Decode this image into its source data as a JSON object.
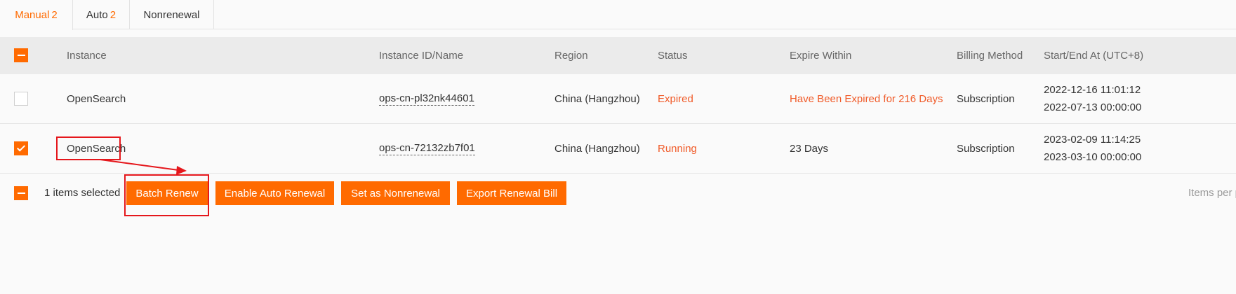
{
  "tabs": [
    {
      "label": "Manual",
      "count": "2"
    },
    {
      "label": "Auto",
      "count": "2"
    },
    {
      "label": "Nonrenewal",
      "count": ""
    }
  ],
  "table": {
    "headers": [
      "Instance",
      "Instance ID/Name",
      "Region",
      "Status",
      "Expire Within",
      "Billing Method",
      "Start/End At (UTC+8)"
    ],
    "rows": [
      {
        "checked": false,
        "instance": "OpenSearch",
        "instance_id": "ops-cn-pl32nk44601",
        "region": "China (Hangzhou)",
        "status": "Expired",
        "expire_within": "Have Been Expired for 216 Days",
        "billing": "Subscription",
        "start": "2022-12-16 11:01:12",
        "end": "2022-07-13 00:00:00"
      },
      {
        "checked": true,
        "instance": "OpenSearch",
        "instance_id": "ops-cn-72132zb7f01",
        "region": "China (Hangzhou)",
        "status": "Running",
        "expire_within": "23 Days",
        "billing": "Subscription",
        "start": "2023-02-09 11:14:25",
        "end": "2023-03-10 00:00:00"
      }
    ]
  },
  "footer": {
    "selected_text": "1 items selected",
    "buttons": {
      "batch_renew": "Batch Renew",
      "enable_auto": "Enable Auto Renewal",
      "nonrenewal": "Set as Nonrenewal",
      "export": "Export Renewal Bill"
    },
    "items_per_page": "Items per p"
  },
  "colors": {
    "accent": "#ff6a00",
    "status_orange": "#f05a28",
    "annotation_red": "#e5171c"
  }
}
